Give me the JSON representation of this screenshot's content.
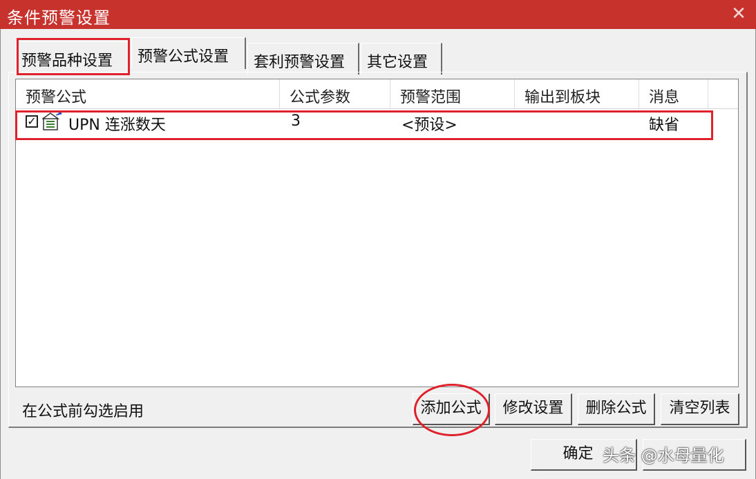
{
  "window": {
    "title": "条件预警设置",
    "close_glyph": "✕"
  },
  "tabs": [
    {
      "label": "预警品种设置"
    },
    {
      "label": "预警公式设置"
    },
    {
      "label": "套利预警设置"
    },
    {
      "label": "其它设置"
    }
  ],
  "table": {
    "columns": [
      "预警公式",
      "公式参数",
      "预警范围",
      "输出到板块",
      "消息"
    ],
    "rows": [
      {
        "checked": true,
        "formula": "UPN 连涨数天",
        "params": "3",
        "range": "<预设>",
        "output": "",
        "message": "缺省"
      }
    ]
  },
  "hint": "在公式前勾选启用",
  "buttons": {
    "add": "添加公式",
    "modify": "修改设置",
    "delete": "删除公式",
    "clear": "清空列表",
    "ok": "确定"
  },
  "watermark": "头条 @水母量化",
  "colors": {
    "titlebar": "#c8322d",
    "highlight": "#e0202a"
  }
}
